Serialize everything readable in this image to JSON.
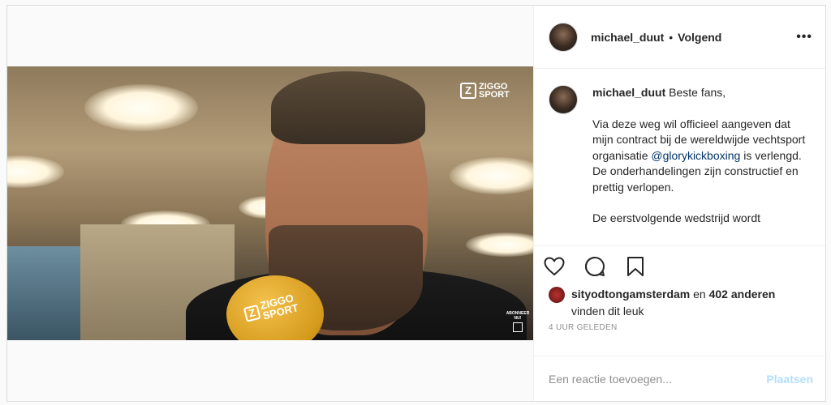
{
  "header": {
    "username": "michael_duut",
    "separator": "•",
    "follow_status": "Volgend",
    "more_icon": "more-options-icon"
  },
  "video": {
    "brand_line1": "ZIGGO",
    "brand_line2": "SPORT",
    "mic_line1": "ZIGGO",
    "mic_line2": "SPORT",
    "corner_line1": "ABONNEER",
    "corner_line2": "NU!"
  },
  "caption": {
    "username": "michael_duut",
    "intro": "Beste fans,",
    "para1_before": "Via deze weg wil officieel aangeven dat mijn contract bij de wereldwijde vechtsport organisatie",
    "mention": "@glorykickboxing",
    "para1_after": "is verlengd. De onderhandelingen zijn constructief en prettig verlopen.",
    "para2": "De eerstvolgende wedstrijd wordt"
  },
  "actions": {
    "like_icon": "heart-icon",
    "comment_icon": "comment-icon",
    "save_icon": "bookmark-icon"
  },
  "likes": {
    "first_liker": "sityodtongamsterdam",
    "connector": "en",
    "others": "402 anderen",
    "suffix": "vinden dit leuk"
  },
  "timestamp": "4 UUR GELEDEN",
  "comment": {
    "placeholder": "Een reactie toevoegen...",
    "post_label": "Plaatsen"
  },
  "colors": {
    "mention": "#003569",
    "post_button_disabled": "#b2dffc",
    "muted_text": "#8e8e8e",
    "border": "#dbdbdb"
  }
}
